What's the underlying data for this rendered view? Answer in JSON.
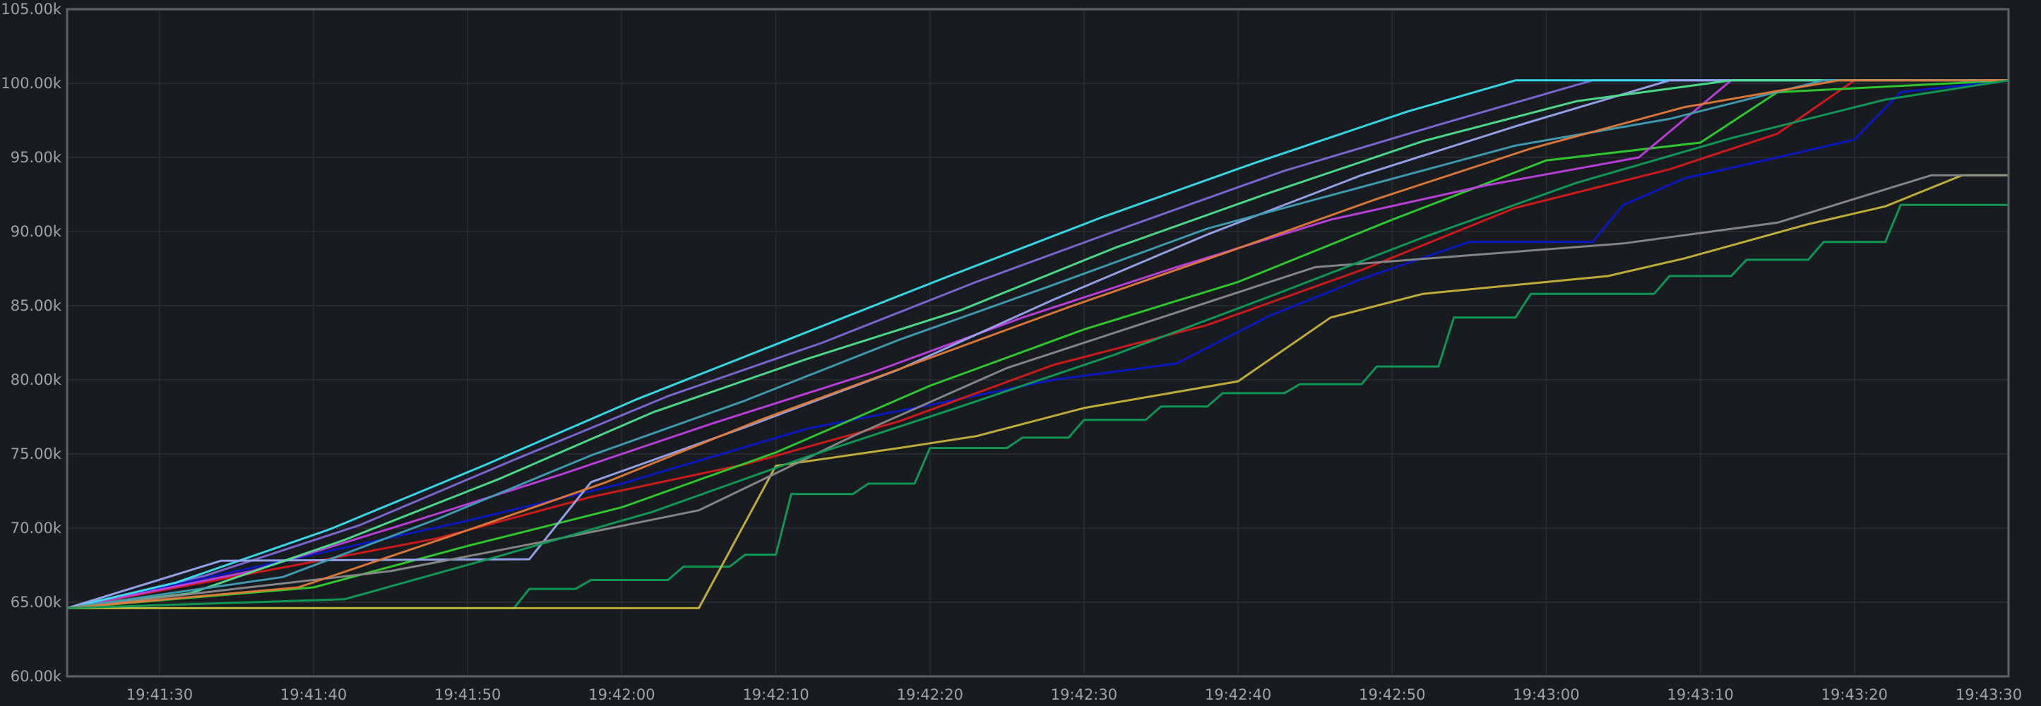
{
  "chart_data": {
    "type": "line",
    "title": "",
    "xlabel": "",
    "ylabel": "",
    "x_range": [
      "19:41:24",
      "19:43:30"
    ],
    "ylim": [
      60000,
      105000
    ],
    "grid": true,
    "legend": "none",
    "y_ticks": [
      {
        "value": 60000,
        "label": "60.00k"
      },
      {
        "value": 65000,
        "label": "65.00k"
      },
      {
        "value": 70000,
        "label": "70.00k"
      },
      {
        "value": 75000,
        "label": "75.00k"
      },
      {
        "value": 80000,
        "label": "80.00k"
      },
      {
        "value": 85000,
        "label": "85.00k"
      },
      {
        "value": 90000,
        "label": "90.00k"
      },
      {
        "value": 95000,
        "label": "95.00k"
      },
      {
        "value": 100000,
        "label": "100.00k"
      },
      {
        "value": 105000,
        "label": "105.00k"
      }
    ],
    "x_ticks": [
      {
        "value": "19:41:30",
        "label": "19:41:30"
      },
      {
        "value": "19:41:40",
        "label": "19:41:40"
      },
      {
        "value": "19:41:50",
        "label": "19:41:50"
      },
      {
        "value": "19:42:00",
        "label": "19:42:00"
      },
      {
        "value": "19:42:10",
        "label": "19:42:10"
      },
      {
        "value": "19:42:20",
        "label": "19:42:20"
      },
      {
        "value": "19:42:30",
        "label": "19:42:30"
      },
      {
        "value": "19:42:40",
        "label": "19:42:40"
      },
      {
        "value": "19:42:50",
        "label": "19:42:50"
      },
      {
        "value": "19:43:00",
        "label": "19:43:00"
      },
      {
        "value": "19:43:10",
        "label": "19:43:10"
      },
      {
        "value": "19:43:20",
        "label": "19:43:20"
      },
      {
        "value": "19:43:30",
        "label": "19:43:30"
      }
    ],
    "series": [
      {
        "color": "#0f9d58",
        "points": [
          [
            "19:41:24",
            64600
          ],
          [
            "19:41:53",
            64600
          ],
          [
            "19:41:54",
            65900
          ],
          [
            "19:41:57",
            65900
          ],
          [
            "19:41:58",
            66500
          ],
          [
            "19:42:03",
            66500
          ],
          [
            "19:42:04",
            67400
          ],
          [
            "19:42:07",
            67400
          ],
          [
            "19:42:08",
            68200
          ],
          [
            "19:42:10",
            68200
          ],
          [
            "19:42:11",
            72300
          ],
          [
            "19:42:15",
            72300
          ],
          [
            "19:42:16",
            73000
          ],
          [
            "19:42:19",
            73000
          ],
          [
            "19:42:20",
            75400
          ],
          [
            "19:42:25",
            75400
          ],
          [
            "19:42:26",
            76100
          ],
          [
            "19:42:29",
            76100
          ],
          [
            "19:42:30",
            77300
          ],
          [
            "19:42:34",
            77300
          ],
          [
            "19:42:35",
            78200
          ],
          [
            "19:42:38",
            78200
          ],
          [
            "19:42:39",
            79100
          ],
          [
            "19:42:43",
            79100
          ],
          [
            "19:42:44",
            79700
          ],
          [
            "19:42:48",
            79700
          ],
          [
            "19:42:49",
            80900
          ],
          [
            "19:42:53",
            80900
          ],
          [
            "19:42:54",
            84200
          ],
          [
            "19:42:58",
            84200
          ],
          [
            "19:42:59",
            85800
          ],
          [
            "19:43:07",
            85800
          ],
          [
            "19:43:08",
            87000
          ],
          [
            "19:43:12",
            87000
          ],
          [
            "19:43:13",
            88100
          ],
          [
            "19:43:17",
            88100
          ],
          [
            "19:43:18",
            89300
          ],
          [
            "19:43:22",
            89300
          ],
          [
            "19:43:23",
            91800
          ],
          [
            "19:43:30",
            91800
          ]
        ]
      },
      {
        "color": "#c8b43a",
        "points": [
          [
            "19:41:24",
            64600
          ],
          [
            "19:42:05",
            64600
          ],
          [
            "19:42:10",
            74200
          ],
          [
            "19:42:18",
            75400
          ],
          [
            "19:42:23",
            76200
          ],
          [
            "19:42:30",
            78100
          ],
          [
            "19:42:40",
            79900
          ],
          [
            "19:42:46",
            84200
          ],
          [
            "19:42:52",
            85800
          ],
          [
            "19:43:04",
            87000
          ],
          [
            "19:43:09",
            88200
          ],
          [
            "19:43:17",
            90500
          ],
          [
            "19:43:22",
            91700
          ],
          [
            "19:43:27",
            93800
          ],
          [
            "19:43:30",
            93800
          ]
        ]
      },
      {
        "color": "#0b18c8",
        "points": [
          [
            "19:41:24",
            64600
          ],
          [
            "19:41:50",
            70500
          ],
          [
            "19:42:00",
            73000
          ],
          [
            "19:42:12",
            76700
          ],
          [
            "19:42:20",
            78300
          ],
          [
            "19:42:28",
            80000
          ],
          [
            "19:42:36",
            81100
          ],
          [
            "19:42:42",
            84300
          ],
          [
            "19:42:48",
            86800
          ],
          [
            "19:42:55",
            89300
          ],
          [
            "19:43:03",
            89300
          ],
          [
            "19:43:05",
            91800
          ],
          [
            "19:43:09",
            93600
          ],
          [
            "19:43:15",
            95000
          ],
          [
            "19:43:20",
            96200
          ],
          [
            "19:43:23",
            99400
          ],
          [
            "19:43:30",
            100200
          ]
        ]
      },
      {
        "color": "#d61a1a",
        "points": [
          [
            "19:41:24",
            64600
          ],
          [
            "19:41:48",
            69300
          ],
          [
            "19:41:58",
            72100
          ],
          [
            "19:42:08",
            74300
          ],
          [
            "19:42:18",
            77200
          ],
          [
            "19:42:28",
            81000
          ],
          [
            "19:42:38",
            83700
          ],
          [
            "19:42:48",
            87400
          ],
          [
            "19:42:58",
            91600
          ],
          [
            "19:43:08",
            94200
          ],
          [
            "19:43:15",
            96600
          ],
          [
            "19:43:20",
            100200
          ],
          [
            "19:43:30",
            100200
          ]
        ]
      },
      {
        "color": "#2fcf2f",
        "points": [
          [
            "19:41:24",
            64600
          ],
          [
            "19:41:40",
            66000
          ],
          [
            "19:41:50",
            68800
          ],
          [
            "19:42:00",
            71400
          ],
          [
            "19:42:10",
            75100
          ],
          [
            "19:42:20",
            79600
          ],
          [
            "19:42:30",
            83400
          ],
          [
            "19:42:40",
            86600
          ],
          [
            "19:42:50",
            90800
          ],
          [
            "19:43:00",
            94800
          ],
          [
            "19:43:10",
            96000
          ],
          [
            "19:43:15",
            99400
          ],
          [
            "19:43:30",
            100200
          ]
        ]
      },
      {
        "color": "#bf3fe0",
        "points": [
          [
            "19:41:24",
            64600
          ],
          [
            "19:41:36",
            67100
          ],
          [
            "19:41:46",
            70300
          ],
          [
            "19:41:56",
            73600
          ],
          [
            "19:42:06",
            77100
          ],
          [
            "19:42:16",
            80400
          ],
          [
            "19:42:26",
            84200
          ],
          [
            "19:42:36",
            87600
          ],
          [
            "19:42:46",
            90800
          ],
          [
            "19:42:56",
            93100
          ],
          [
            "19:43:06",
            95000
          ],
          [
            "19:43:12",
            100200
          ],
          [
            "19:43:30",
            100200
          ]
        ]
      },
      {
        "color": "#7f68d8",
        "points": [
          [
            "19:41:24",
            64600
          ],
          [
            "19:41:33",
            66800
          ],
          [
            "19:41:43",
            70200
          ],
          [
            "19:41:53",
            74600
          ],
          [
            "19:42:03",
            78900
          ],
          [
            "19:42:13",
            82500
          ],
          [
            "19:42:23",
            86600
          ],
          [
            "19:42:33",
            90400
          ],
          [
            "19:42:43",
            94100
          ],
          [
            "19:42:53",
            97200
          ],
          [
            "19:43:03",
            100200
          ],
          [
            "19:43:30",
            100200
          ]
        ]
      },
      {
        "color": "#35e2ef",
        "points": [
          [
            "19:41:24",
            64600
          ],
          [
            "19:41:31",
            66300
          ],
          [
            "19:41:41",
            69900
          ],
          [
            "19:41:51",
            74200
          ],
          [
            "19:42:01",
            78700
          ],
          [
            "19:42:11",
            82800
          ],
          [
            "19:42:21",
            86900
          ],
          [
            "19:42:31",
            90900
          ],
          [
            "19:42:41",
            94600
          ],
          [
            "19:42:51",
            98100
          ],
          [
            "19:42:58",
            100200
          ],
          [
            "19:43:30",
            100200
          ]
        ]
      },
      {
        "color": "#99a6f0",
        "points": [
          [
            "19:41:24",
            64600
          ],
          [
            "19:41:34",
            67800
          ],
          [
            "19:41:54",
            67900
          ],
          [
            "19:41:58",
            73100
          ],
          [
            "19:42:08",
            76800
          ],
          [
            "19:42:18",
            80700
          ],
          [
            "19:42:28",
            85400
          ],
          [
            "19:42:38",
            89800
          ],
          [
            "19:42:48",
            93800
          ],
          [
            "19:42:58",
            97100
          ],
          [
            "19:43:08",
            100200
          ],
          [
            "19:43:30",
            100200
          ]
        ]
      },
      {
        "color": "#4de28d",
        "points": [
          [
            "19:41:24",
            64600
          ],
          [
            "19:41:32",
            65600
          ],
          [
            "19:41:42",
            69200
          ],
          [
            "19:41:52",
            73300
          ],
          [
            "19:42:02",
            77800
          ],
          [
            "19:42:12",
            81400
          ],
          [
            "19:42:22",
            84700
          ],
          [
            "19:42:32",
            88900
          ],
          [
            "19:42:42",
            92600
          ],
          [
            "19:42:52",
            96100
          ],
          [
            "19:43:02",
            98800
          ],
          [
            "19:43:12",
            100200
          ],
          [
            "19:43:30",
            100200
          ]
        ]
      },
      {
        "color": "#8a8a8a",
        "points": [
          [
            "19:41:24",
            64600
          ],
          [
            "19:41:45",
            67100
          ],
          [
            "19:41:55",
            69100
          ],
          [
            "19:42:05",
            71200
          ],
          [
            "19:42:15",
            76200
          ],
          [
            "19:42:25",
            80800
          ],
          [
            "19:42:35",
            84200
          ],
          [
            "19:42:45",
            87600
          ],
          [
            "19:42:55",
            88400
          ],
          [
            "19:43:05",
            89200
          ],
          [
            "19:43:15",
            90600
          ],
          [
            "19:43:25",
            93800
          ],
          [
            "19:43:30",
            93800
          ]
        ]
      },
      {
        "color": "#3f9fb6",
        "points": [
          [
            "19:41:24",
            64600
          ],
          [
            "19:41:38",
            66700
          ],
          [
            "19:41:48",
            70600
          ],
          [
            "19:41:58",
            74900
          ],
          [
            "19:42:08",
            78600
          ],
          [
            "19:42:18",
            82700
          ],
          [
            "19:42:28",
            86400
          ],
          [
            "19:42:38",
            90200
          ],
          [
            "19:42:48",
            93000
          ],
          [
            "19:42:58",
            95800
          ],
          [
            "19:43:08",
            97600
          ],
          [
            "19:43:18",
            100200
          ],
          [
            "19:43:30",
            100200
          ]
        ]
      },
      {
        "color": "#e17a3a",
        "points": [
          [
            "19:41:24",
            64600
          ],
          [
            "19:41:39",
            66000
          ],
          [
            "19:41:49",
            69500
          ],
          [
            "19:41:59",
            73100
          ],
          [
            "19:42:09",
            77300
          ],
          [
            "19:42:19",
            81100
          ],
          [
            "19:42:29",
            84900
          ],
          [
            "19:42:39",
            88500
          ],
          [
            "19:42:49",
            92200
          ],
          [
            "19:42:59",
            95600
          ],
          [
            "19:43:09",
            98400
          ],
          [
            "19:43:19",
            100200
          ],
          [
            "19:43:30",
            100200
          ]
        ]
      },
      {
        "color": "#0f9d58",
        "points": [
          [
            "19:41:24",
            64600
          ],
          [
            "19:41:42",
            65200
          ],
          [
            "19:41:52",
            68100
          ],
          [
            "19:42:02",
            71100
          ],
          [
            "19:42:12",
            74800
          ],
          [
            "19:42:22",
            78200
          ],
          [
            "19:42:32",
            81700
          ],
          [
            "19:42:42",
            85600
          ],
          [
            "19:42:52",
            89600
          ],
          [
            "19:43:02",
            93300
          ],
          [
            "19:43:12",
            96300
          ],
          [
            "19:43:22",
            98900
          ],
          [
            "19:43:30",
            100200
          ]
        ]
      }
    ]
  }
}
